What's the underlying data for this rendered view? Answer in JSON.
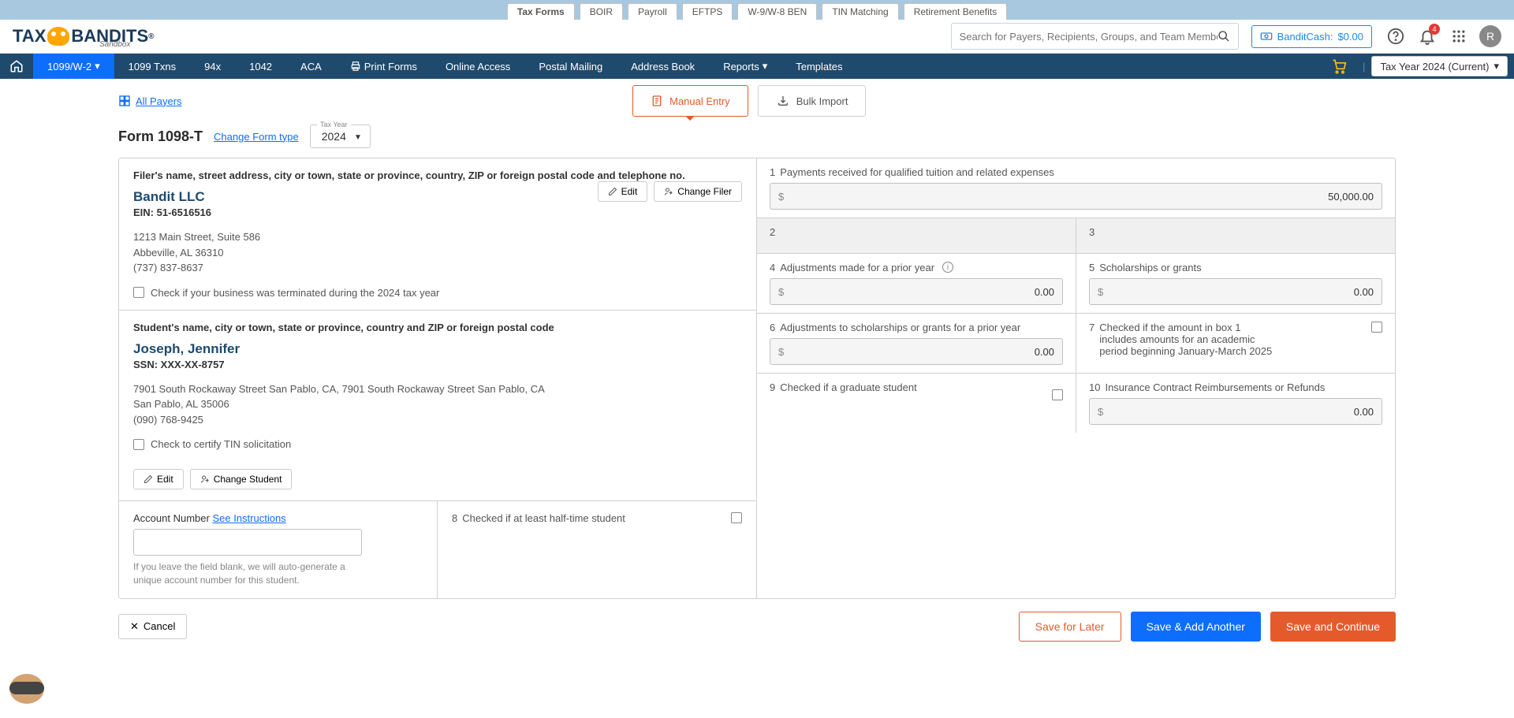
{
  "topTabs": {
    "taxForms": "Tax Forms",
    "boir": "BOIR",
    "payroll": "Payroll",
    "eftps": "EFTPS",
    "w9w8": "W-9/W-8 BEN",
    "tinMatching": "TIN Matching",
    "retirement": "Retirement Benefits"
  },
  "logo": {
    "part1": "TAX",
    "part2": "BANDITS",
    "reg": "®",
    "sandbox": "Sandbox"
  },
  "header": {
    "searchPlaceholder": "Search for Payers, Recipients, Groups, and Team Members",
    "banditCashLabel": "BanditCash:",
    "banditCashValue": "$0.00",
    "notifCount": "4",
    "avatarInitial": "R"
  },
  "nav": {
    "n1099": "1099/W-2",
    "txns": "1099 Txns",
    "n94x": "94x",
    "n1042": "1042",
    "aca": "ACA",
    "printForms": "Print Forms",
    "onlineAccess": "Online Access",
    "postalMailing": "Postal Mailing",
    "addressBook": "Address Book",
    "reports": "Reports",
    "templates": "Templates",
    "taxYear": "Tax Year 2024 (Current)"
  },
  "entryTabs": {
    "allPayers": "All Payers",
    "manualEntry": "Manual Entry",
    "bulkImport": "Bulk Import"
  },
  "formHeader": {
    "title": "Form 1098-T",
    "changeType": "Change Form type",
    "yearLabel": "Tax Year",
    "yearValue": "2024"
  },
  "filer": {
    "sectionTitle": "Filer's name, street address, city or town, state or province, country, ZIP or foreign postal code and telephone no.",
    "name": "Bandit LLC",
    "einLabel": "EIN: 51-6516516",
    "addr1": "1213 Main Street, Suite 586",
    "addr2": "Abbeville, AL 36310",
    "phone": "(737) 837-8637",
    "terminatedCheck": "Check if your business was terminated during the 2024 tax year",
    "editBtn": "Edit",
    "changeFilerBtn": "Change Filer"
  },
  "student": {
    "sectionTitle": "Student's name, city or town, state or province, country and ZIP or foreign postal code",
    "name": "Joseph, Jennifer",
    "ssnLabel": "SSN: XXX-XX-8757",
    "addr1": "7901 South Rockaway Street San Pablo, CA, 7901 South Rockaway Street San Pablo, CA",
    "addr2": "San Pablo, AL 35006",
    "phone": "(090) 768-9425",
    "tinCheck": "Check to certify TIN solicitation",
    "editBtn": "Edit",
    "changeStudentBtn": "Change Student"
  },
  "boxes": {
    "b1": {
      "num": "1",
      "label": "Payments received for qualified tuition and related expenses",
      "value": "50,000.00"
    },
    "b2": {
      "num": "2"
    },
    "b3": {
      "num": "3"
    },
    "b4": {
      "num": "4",
      "label": "Adjustments made for a prior year",
      "value": "0.00"
    },
    "b5": {
      "num": "5",
      "label": "Scholarships or grants",
      "value": "0.00"
    },
    "b6": {
      "num": "6",
      "label": "Adjustments to scholarships or grants for a prior year",
      "value": "0.00"
    },
    "b7": {
      "num": "7",
      "label": "Checked if the amount in box 1 includes amounts for an academic period beginning January-March 2025"
    },
    "b8": {
      "num": "8",
      "label": "Checked if at least half-time student"
    },
    "b9": {
      "num": "9",
      "label": "Checked if a graduate student"
    },
    "b10": {
      "num": "10",
      "label": "Insurance Contract Reimbursements or Refunds",
      "value": "0.00"
    }
  },
  "account": {
    "label": "Account Number",
    "seeInstr": "See Instructions",
    "helper": "If you leave the field blank, we will auto-generate a unique account number for this student."
  },
  "footer": {
    "cancel": "Cancel",
    "saveLater": "Save for Later",
    "saveAdd": "Save & Add Another",
    "saveCont": "Save and Continue"
  }
}
